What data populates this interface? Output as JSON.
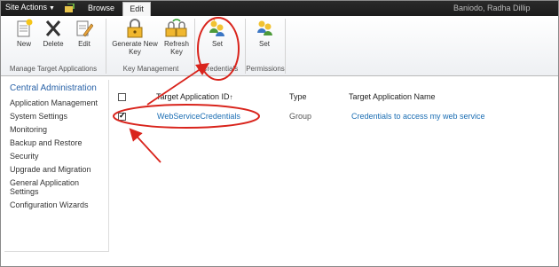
{
  "topbar": {
    "site_actions": "Site Actions",
    "tabs": [
      {
        "label": "Browse"
      },
      {
        "label": "Edit"
      }
    ],
    "user": "Baniodo, Radha Dillip"
  },
  "ribbon": {
    "buttons": [
      {
        "label": "New"
      },
      {
        "label": "Delete"
      },
      {
        "label": "Edit"
      },
      {
        "label": "Generate New Key"
      },
      {
        "label": "Refresh Key"
      },
      {
        "label": "Set"
      },
      {
        "label": "Set"
      }
    ],
    "groups": [
      {
        "label": "Manage Target Applications"
      },
      {
        "label": "Key Management"
      },
      {
        "label": "Credentials"
      },
      {
        "label": "Permissions"
      }
    ]
  },
  "leftnav": {
    "heading": "Central Administration",
    "items": [
      {
        "label": "Application Management"
      },
      {
        "label": "System Settings"
      },
      {
        "label": "Monitoring"
      },
      {
        "label": "Backup and Restore"
      },
      {
        "label": "Security"
      },
      {
        "label": "Upgrade and Migration"
      },
      {
        "label": "General Application Settings"
      },
      {
        "label": "Configuration Wizards"
      }
    ]
  },
  "table": {
    "headers": {
      "id": "Target Application ID",
      "sort": "↑",
      "type": "Type",
      "name": "Target Application Name"
    },
    "rows": [
      {
        "id": "WebServiceCredentials",
        "type": "Group",
        "name": "Credentials to access my web service",
        "checked": true
      }
    ]
  },
  "colors": {
    "annotation": "#d9241c",
    "link": "#1a6db3",
    "accent": "#2a63a8"
  }
}
